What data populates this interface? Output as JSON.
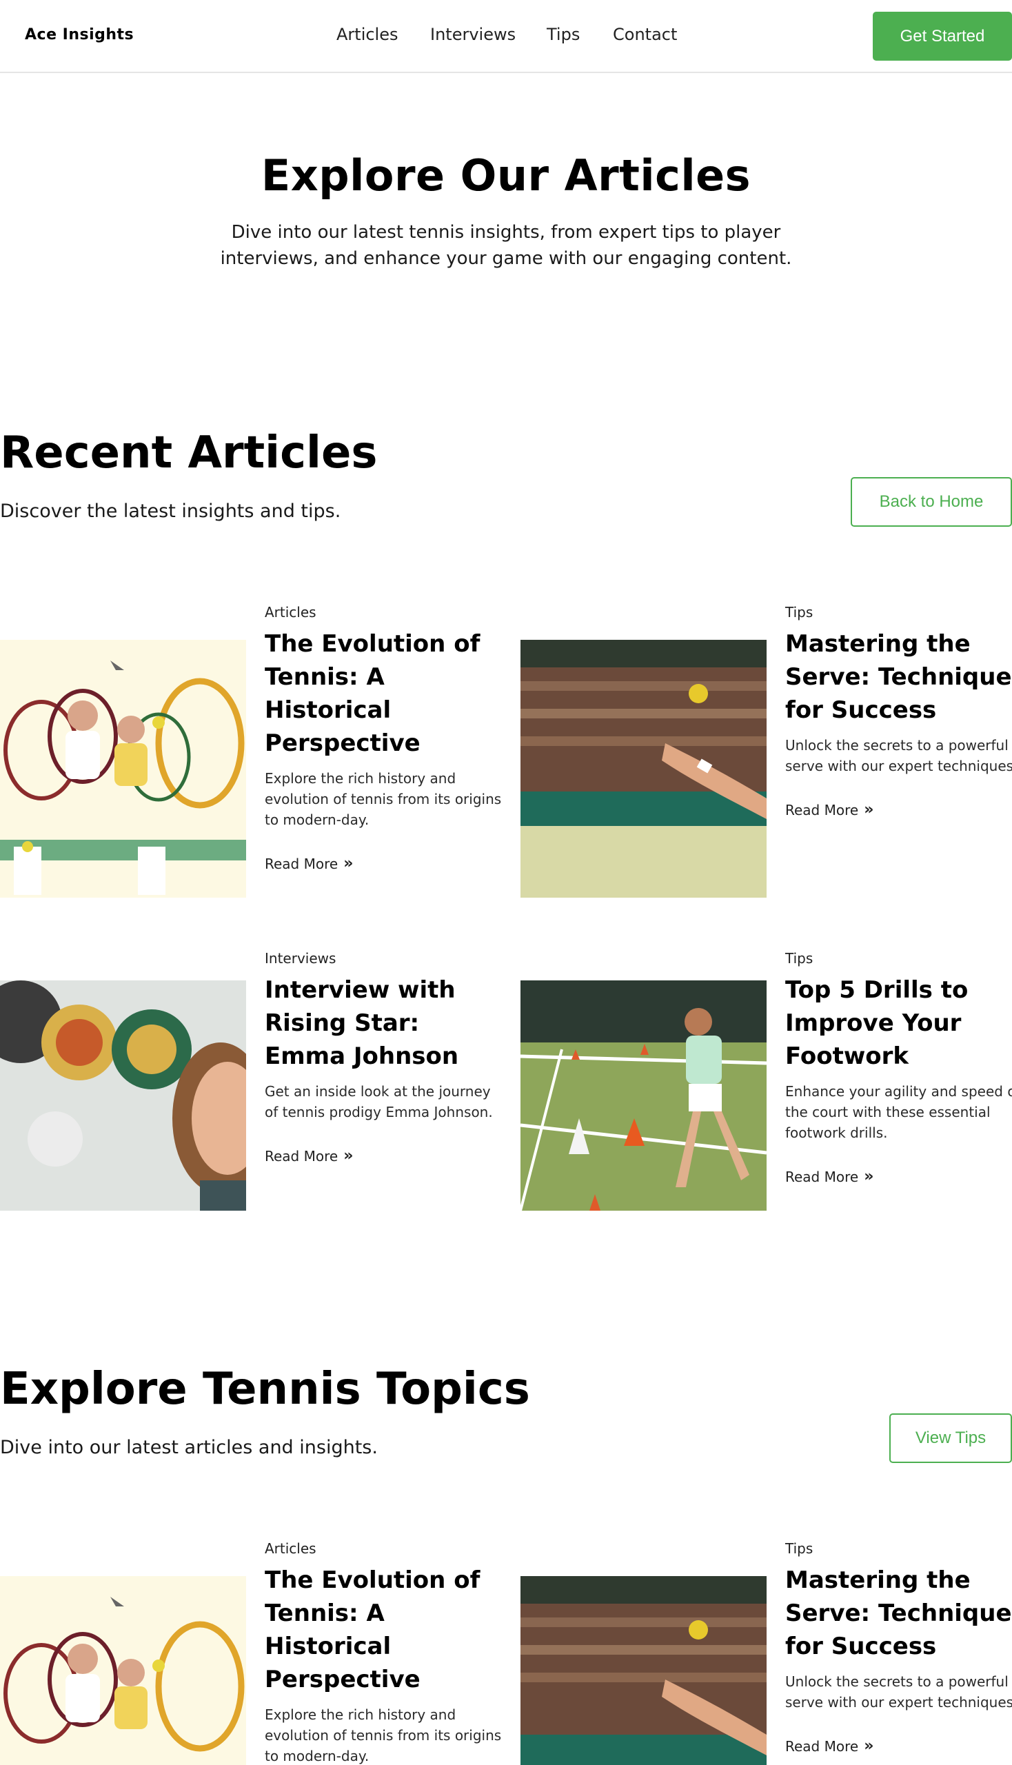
{
  "header": {
    "logo": "Ace Insights",
    "nav": [
      "Articles",
      "Interviews",
      "Tips",
      "Contact"
    ],
    "cta_label": "Get Started"
  },
  "hero": {
    "title": "Explore Our Articles",
    "subtitle": "Dive into our latest tennis insights, from expert tips to player interviews, and enhance your game with our engaging content."
  },
  "recent": {
    "title": "Recent Articles",
    "subtitle": "Discover the latest insights and tips.",
    "button_label": "Back to Home",
    "cards": [
      {
        "category": "Articles",
        "title": "The Evolution of Tennis: A Historical Perspective",
        "description": "Explore the rich history and evolution of tennis from its origins to modern-day.",
        "link": "Read More",
        "image": "tennis-history-collage"
      },
      {
        "category": "Tips",
        "title": "Mastering the Serve: Techniques for Success",
        "description": "Unlock the secrets to a powerful serve with our expert techniques.",
        "link": "Read More",
        "image": "serve-stadium"
      },
      {
        "category": "Interviews",
        "title": "Interview with Rising Star: Emma Johnson",
        "description": "Get an inside look at the journey of tennis prodigy Emma Johnson.",
        "link": "Read More",
        "image": "player-portrait"
      },
      {
        "category": "Tips",
        "title": "Top 5 Drills to Improve Your Footwork",
        "description": "Enhance your agility and speed on the court with these essential footwork drills.",
        "link": "Read More",
        "image": "footwork-cones"
      }
    ]
  },
  "topics": {
    "title": "Explore Tennis Topics",
    "subtitle": "Dive into our latest articles and insights.",
    "button_label": "View Tips",
    "cards": [
      {
        "category": "Articles",
        "title": "The Evolution of Tennis: A Historical Perspective",
        "description": "Explore the rich history and evolution of tennis from its origins to modern-day.",
        "image": "tennis-history-collage"
      },
      {
        "category": "Tips",
        "title": "Mastering the Serve: Techniques for Success",
        "description": "Unlock the secrets to a powerful serve with our expert techniques.",
        "link": "Read More",
        "image": "serve-stadium"
      }
    ]
  },
  "colors": {
    "accent": "#4caf50",
    "text": "#111111",
    "border": "#e5e5e5"
  }
}
